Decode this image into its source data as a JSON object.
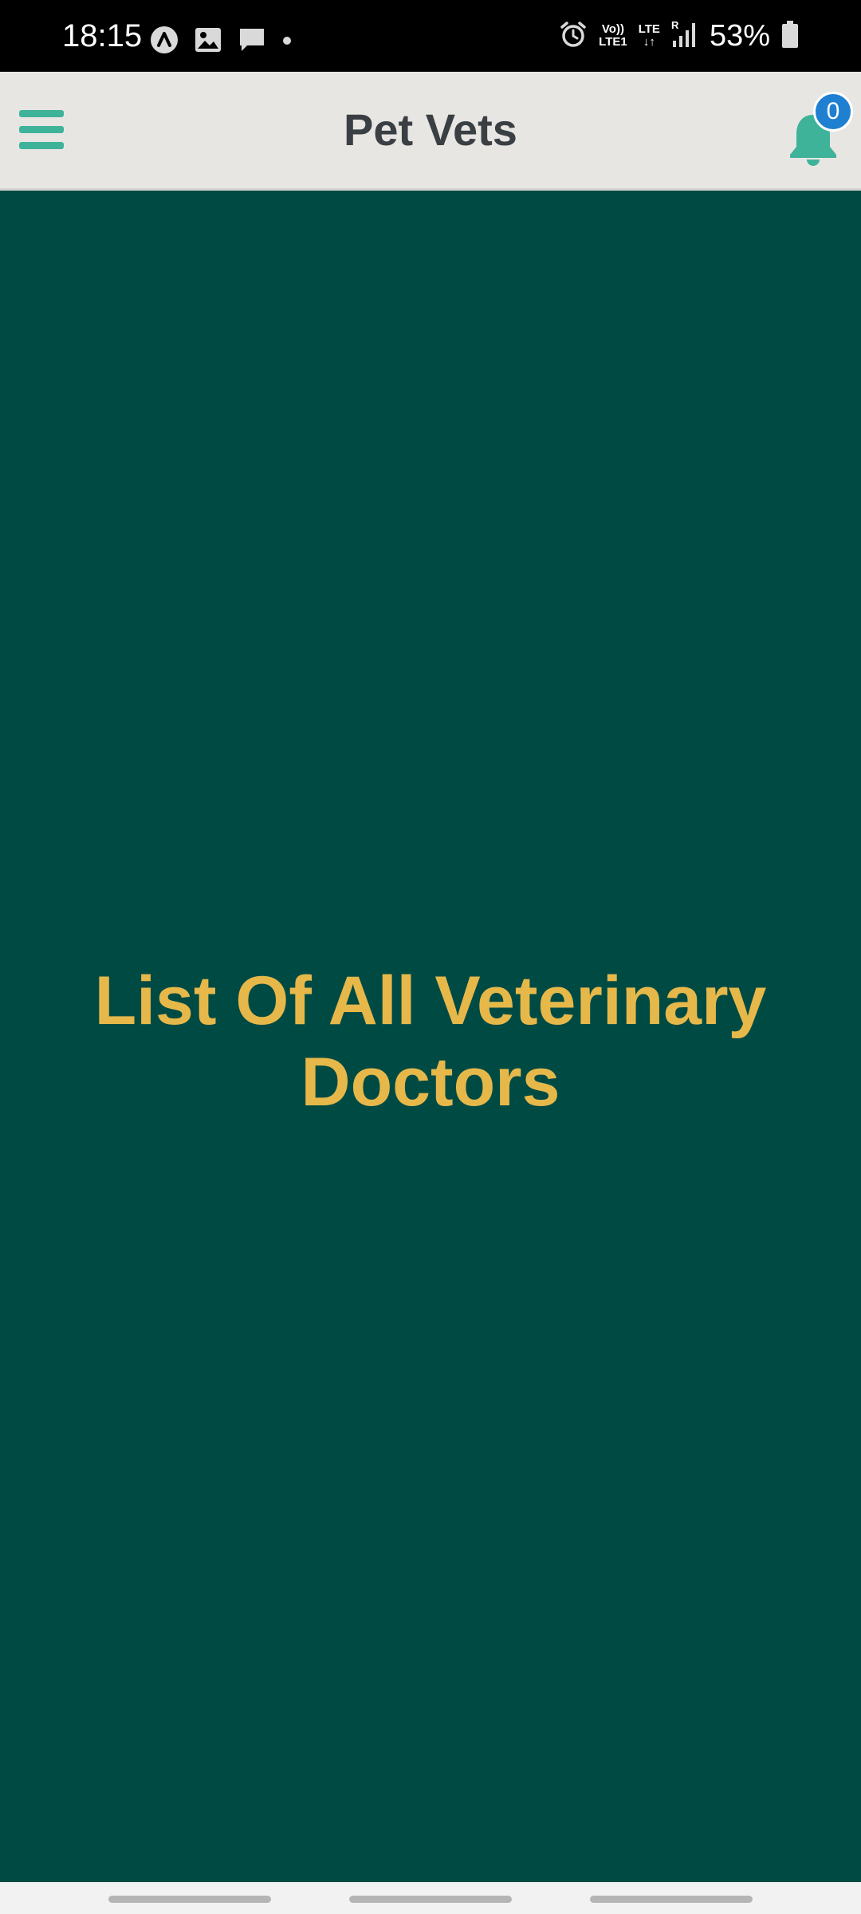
{
  "status_bar": {
    "time": "18:15",
    "left_icons": [
      "app-a-icon",
      "image-icon",
      "message-icon",
      "dot-icon"
    ],
    "network_volte": "Vo))\nLTE1",
    "network_lte": "LTE\n↓↑",
    "network_roaming": "R",
    "battery_percent": "53%"
  },
  "header": {
    "title": "Pet Vets",
    "notification_count": "0"
  },
  "main": {
    "heading_line1": "List Of All Veterinary",
    "heading_line2": "Doctors"
  },
  "colors": {
    "background": "#004a44",
    "header_bg": "#e8e6e2",
    "accent_green": "#3fb39a",
    "heading_yellow": "#e6b84a",
    "title_text": "#3a3f44",
    "badge_blue": "#1f7fd0"
  }
}
